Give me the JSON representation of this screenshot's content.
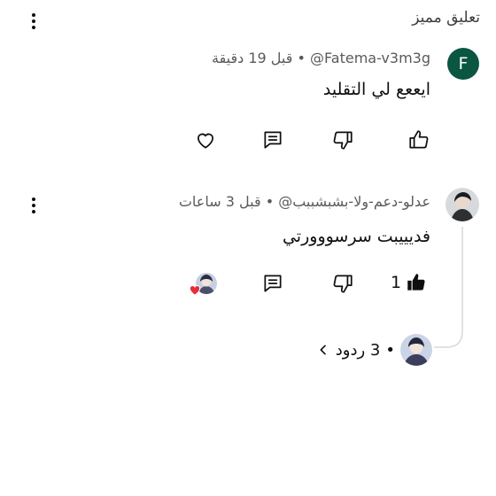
{
  "featured_label": "تعليق مميز",
  "comments": [
    {
      "avatar_letter": "F",
      "handle": "@Fatema-v3m3g",
      "time": "قبل 19 دقيقة",
      "separator": "•",
      "text": "ايععع لي التقليد"
    },
    {
      "handle": "@عدلو-دعم-ولا-بشبشببب",
      "time": "قبل 3 ساعات",
      "separator": "•",
      "text": "فديييبت سرسووورتي",
      "like_count": "1",
      "replies_label": "3 ردود",
      "replies_separator": "•"
    }
  ],
  "icons": [
    "like-icon",
    "dislike-icon",
    "reply-icon",
    "heart-icon",
    "more-vert-icon",
    "chevron-right-icon"
  ],
  "colors": {
    "avatar_bg": "#0b5640",
    "heart": "#e62e3b",
    "thread_line": "#d9d9d9"
  }
}
